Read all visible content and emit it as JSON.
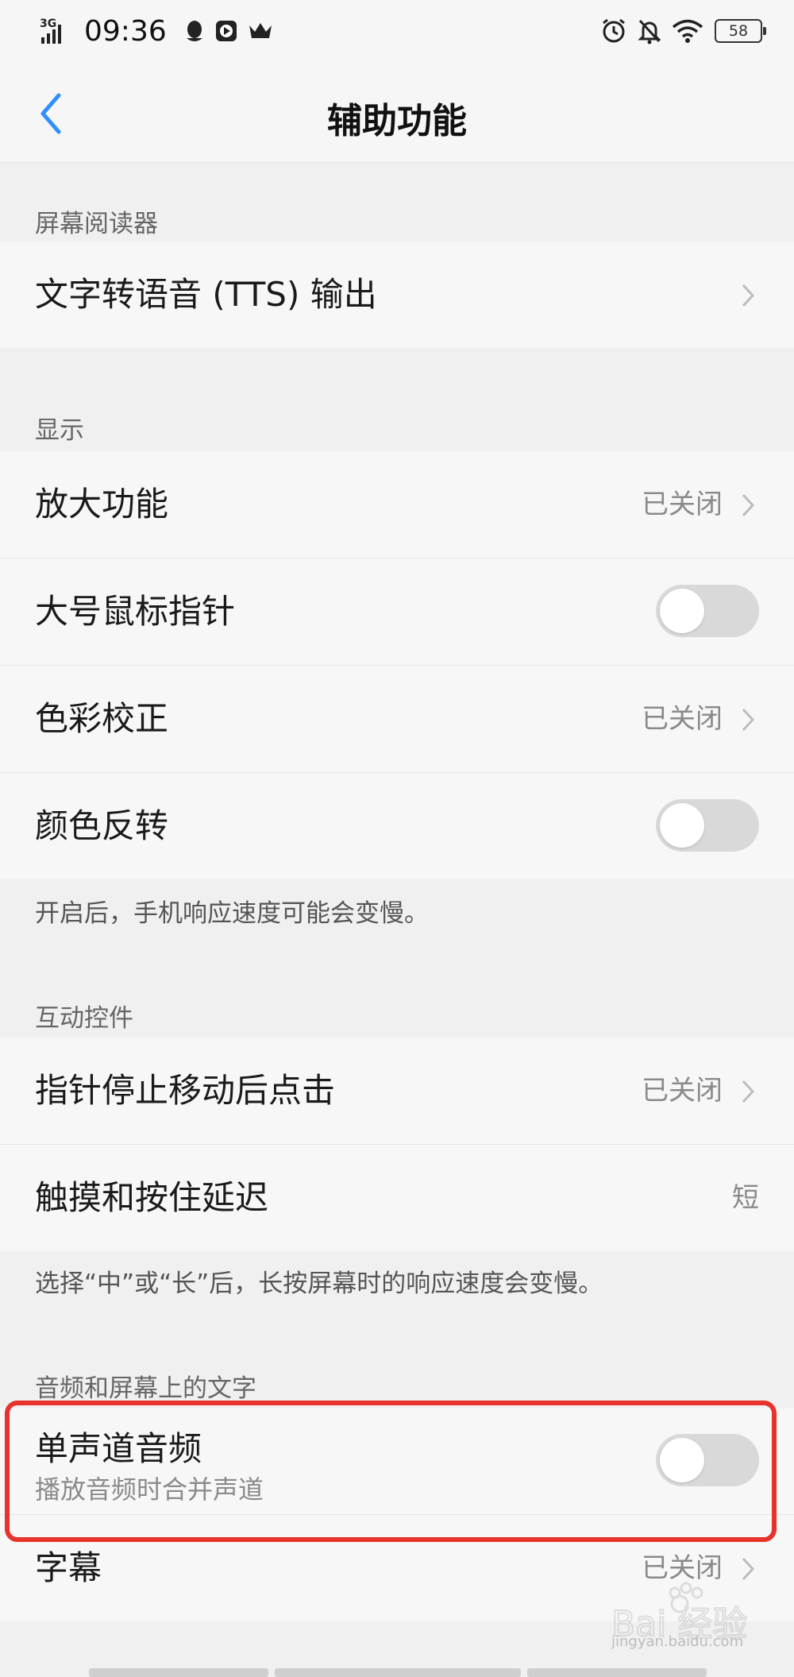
{
  "status_bar": {
    "network": "3G",
    "time": "09:36",
    "battery": "58"
  },
  "header": {
    "title": "辅助功能"
  },
  "sections": {
    "screen_reader": {
      "title": "屏幕阅读器",
      "items": [
        {
          "label": "文字转语音 (TTS) 输出"
        }
      ]
    },
    "display": {
      "title": "显示",
      "items": [
        {
          "label": "放大功能",
          "value": "已关闭"
        },
        {
          "label": "大号鼠标指针",
          "toggle": false
        },
        {
          "label": "色彩校正",
          "value": "已关闭"
        },
        {
          "label": "颜色反转",
          "toggle": false
        }
      ],
      "note": "开启后，手机响应速度可能会变慢。"
    },
    "interaction": {
      "title": "互动控件",
      "items": [
        {
          "label": "指针停止移动后点击",
          "value": "已关闭"
        },
        {
          "label": "触摸和按住延迟",
          "value": "短"
        }
      ],
      "note": "选择“中”或“长”后，长按屏幕时的响应速度会变慢。"
    },
    "audio_text": {
      "title": "音频和屏幕上的文字",
      "items": [
        {
          "label": "单声道音频",
          "sublabel": "播放音频时合并声道",
          "toggle": false
        },
        {
          "label": "字幕",
          "value": "已关闭"
        }
      ]
    }
  },
  "watermark": {
    "brand": "Bai 经验",
    "url": "jingyan.baidu.com"
  },
  "colors": {
    "accent": "#2f8fff",
    "highlight": "#e8322c",
    "toggle_off": "#d9d9d9"
  }
}
